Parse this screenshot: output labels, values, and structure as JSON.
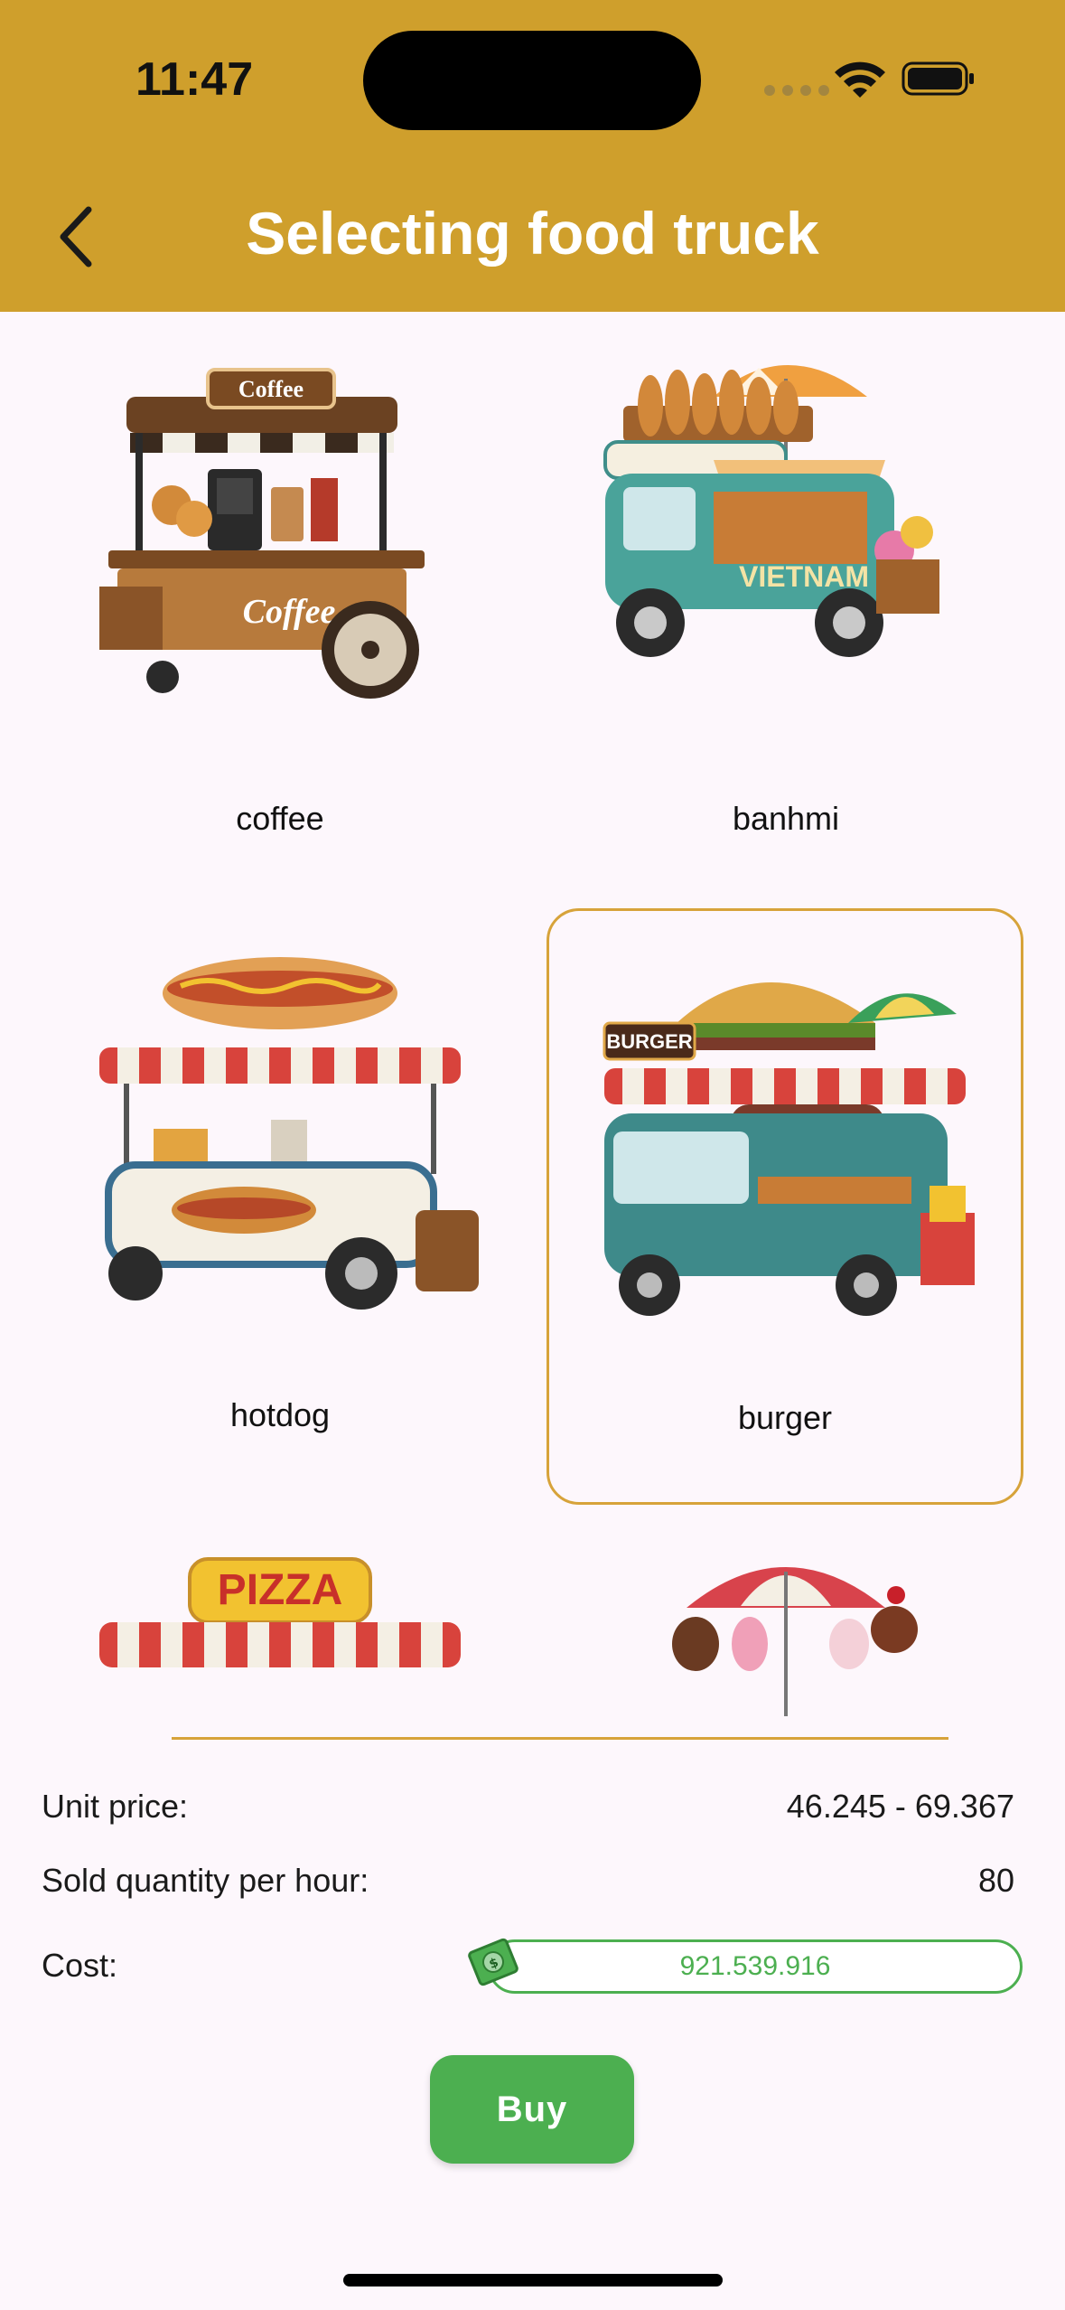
{
  "status_bar": {
    "time": "11:47"
  },
  "header": {
    "title": "Selecting food truck",
    "back_icon": "chevron-left-icon"
  },
  "trucks": [
    {
      "label": "coffee",
      "selected": false
    },
    {
      "label": "banhmi",
      "selected": false
    },
    {
      "label": "hotdog",
      "selected": false
    },
    {
      "label": "burger",
      "selected": true
    },
    {
      "label": "pizza",
      "selected": false
    },
    {
      "label": "icecream",
      "selected": false
    }
  ],
  "art_text": {
    "coffee_sign": "Coffee",
    "coffee_cart": "Coffee",
    "vietnam": "VIETNAM",
    "burger_sign": "BURGER",
    "pizza_sign": "PIZZA"
  },
  "info": {
    "unit_price_label": "Unit price:",
    "unit_price_value": "46.245  - 69.367",
    "sold_qty_label": "Sold quantity per hour:",
    "sold_qty_value": "80",
    "cost_label": "Cost:",
    "cost_value": "921.539.916"
  },
  "buy_label": "Buy",
  "colors": {
    "header": "#CF9F2C",
    "accent_green": "#4CAF50",
    "selected_border": "#D7A33A",
    "background": "#FDF7FC"
  }
}
